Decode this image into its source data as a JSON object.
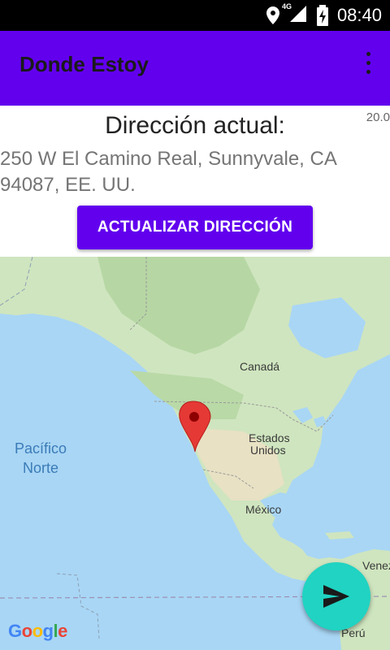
{
  "status_bar": {
    "time": "08:40",
    "network": "4G",
    "icons": [
      "location-icon",
      "signal-icon",
      "battery-charging-icon"
    ]
  },
  "app_bar": {
    "title": "Donde Estoy",
    "menu_icon": "more-vert-icon",
    "color": "#6200ee"
  },
  "header": {
    "coordinate_partial": "20.0",
    "label": "Dirección actual:",
    "address": "250 W El Camino Real, Sunnyvale, CA 94087, EE. UU.",
    "button_label": "ACTUALIZAR DIRECCIÓN"
  },
  "map": {
    "labels": {
      "canada": "Canadá",
      "usa_line1": "Estados",
      "usa_line2": "Unidos",
      "mexico": "México",
      "pacific_line1": "Pacífico",
      "pacific_line2": "Norte",
      "venezuela": "Venez",
      "peru": "Perú"
    },
    "marker_icon": "map-pin-icon",
    "attribution": "Google"
  },
  "fab": {
    "icon": "send-icon",
    "color": "#20d3c2"
  }
}
